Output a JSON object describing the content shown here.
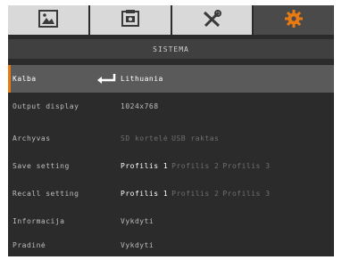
{
  "tabs": [
    {
      "icon": "image-icon",
      "active": false
    },
    {
      "icon": "camera-settings-icon",
      "active": false
    },
    {
      "icon": "tools-icon",
      "active": false
    },
    {
      "icon": "gear-icon",
      "active": true
    }
  ],
  "accent_color": "#e87a12",
  "section_title": "SISTEMA",
  "rows": {
    "kalba": {
      "label": "Kalba",
      "value": "Lithuania"
    },
    "output": {
      "label": "Output display",
      "value": "1024x768"
    },
    "archyvas": {
      "label": "Archyvas",
      "option1": "SD kortelė",
      "option2": "USB raktas"
    },
    "save": {
      "label": "Save setting",
      "option1": "Profilis 1",
      "option2": "Profilis 2",
      "option3": "Profilis 3"
    },
    "recall": {
      "label": "Recall setting",
      "option1": "Profilis 1",
      "option2": "Profilis 2",
      "option3": "Profilis 3"
    },
    "informacija": {
      "label": "Informacija",
      "value": "Vykdyti"
    },
    "pradine": {
      "label": "Pradinė",
      "value": "Vykdyti"
    }
  }
}
